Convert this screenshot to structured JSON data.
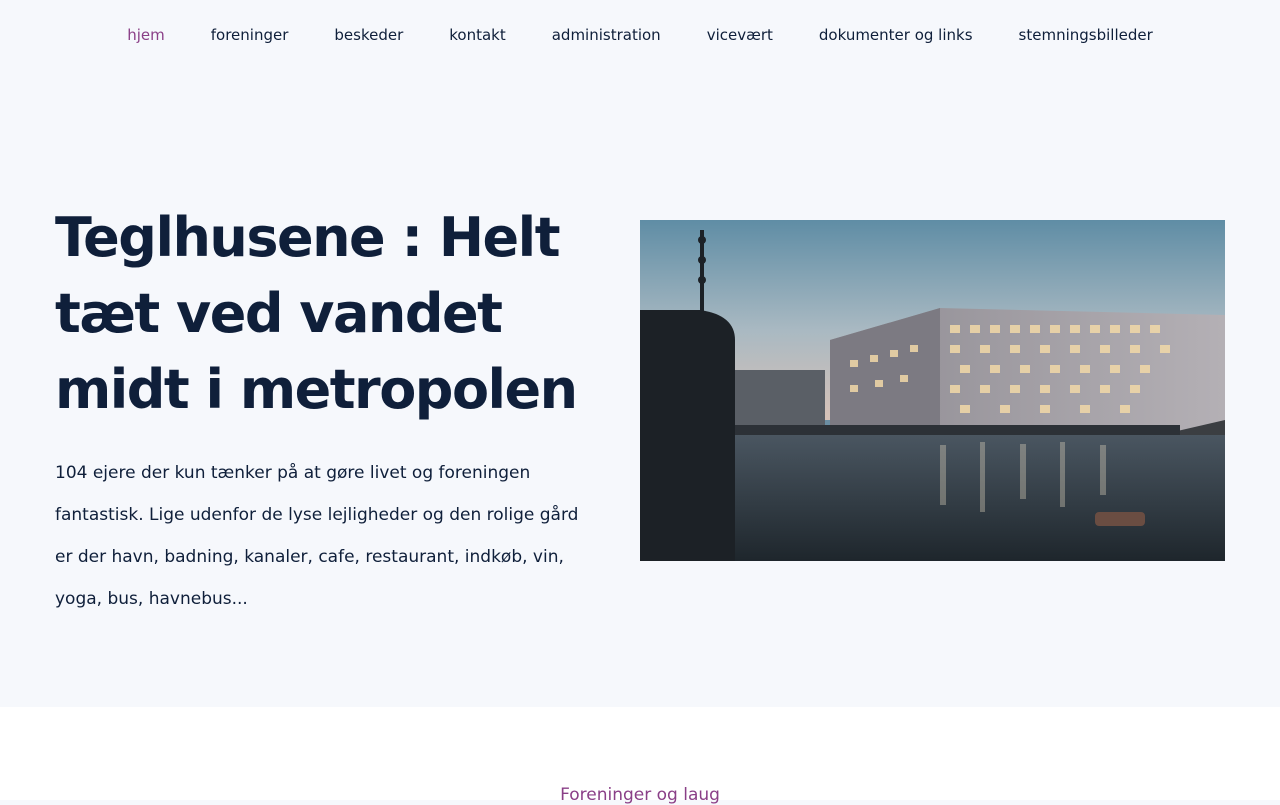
{
  "nav": {
    "items": [
      {
        "label": "hjem",
        "active": true
      },
      {
        "label": "foreninger",
        "active": false
      },
      {
        "label": "beskeder",
        "active": false
      },
      {
        "label": "kontakt",
        "active": false
      },
      {
        "label": "administration",
        "active": false
      },
      {
        "label": "vicevært",
        "active": false
      },
      {
        "label": "dokumenter og links",
        "active": false
      },
      {
        "label": "stemningsbilleder",
        "active": false
      }
    ]
  },
  "hero": {
    "title": "Teglhusene : Helt tæt ved vandet midt i metropolen",
    "body": "104 ejere der kun tænker på at gøre livet og foreningen fantastisk. Lige udenfor de lyse lejligheder og den rolige gård er der havn, badning, kanaler, cafe, restaurant, indkøb, vin, yoga, bus, havnebus..."
  },
  "section2": {
    "label": "Foreninger og laug"
  },
  "colors": {
    "accent": "#8a3f87",
    "text": "#0f1f3a",
    "background": "#f6f8fc"
  }
}
